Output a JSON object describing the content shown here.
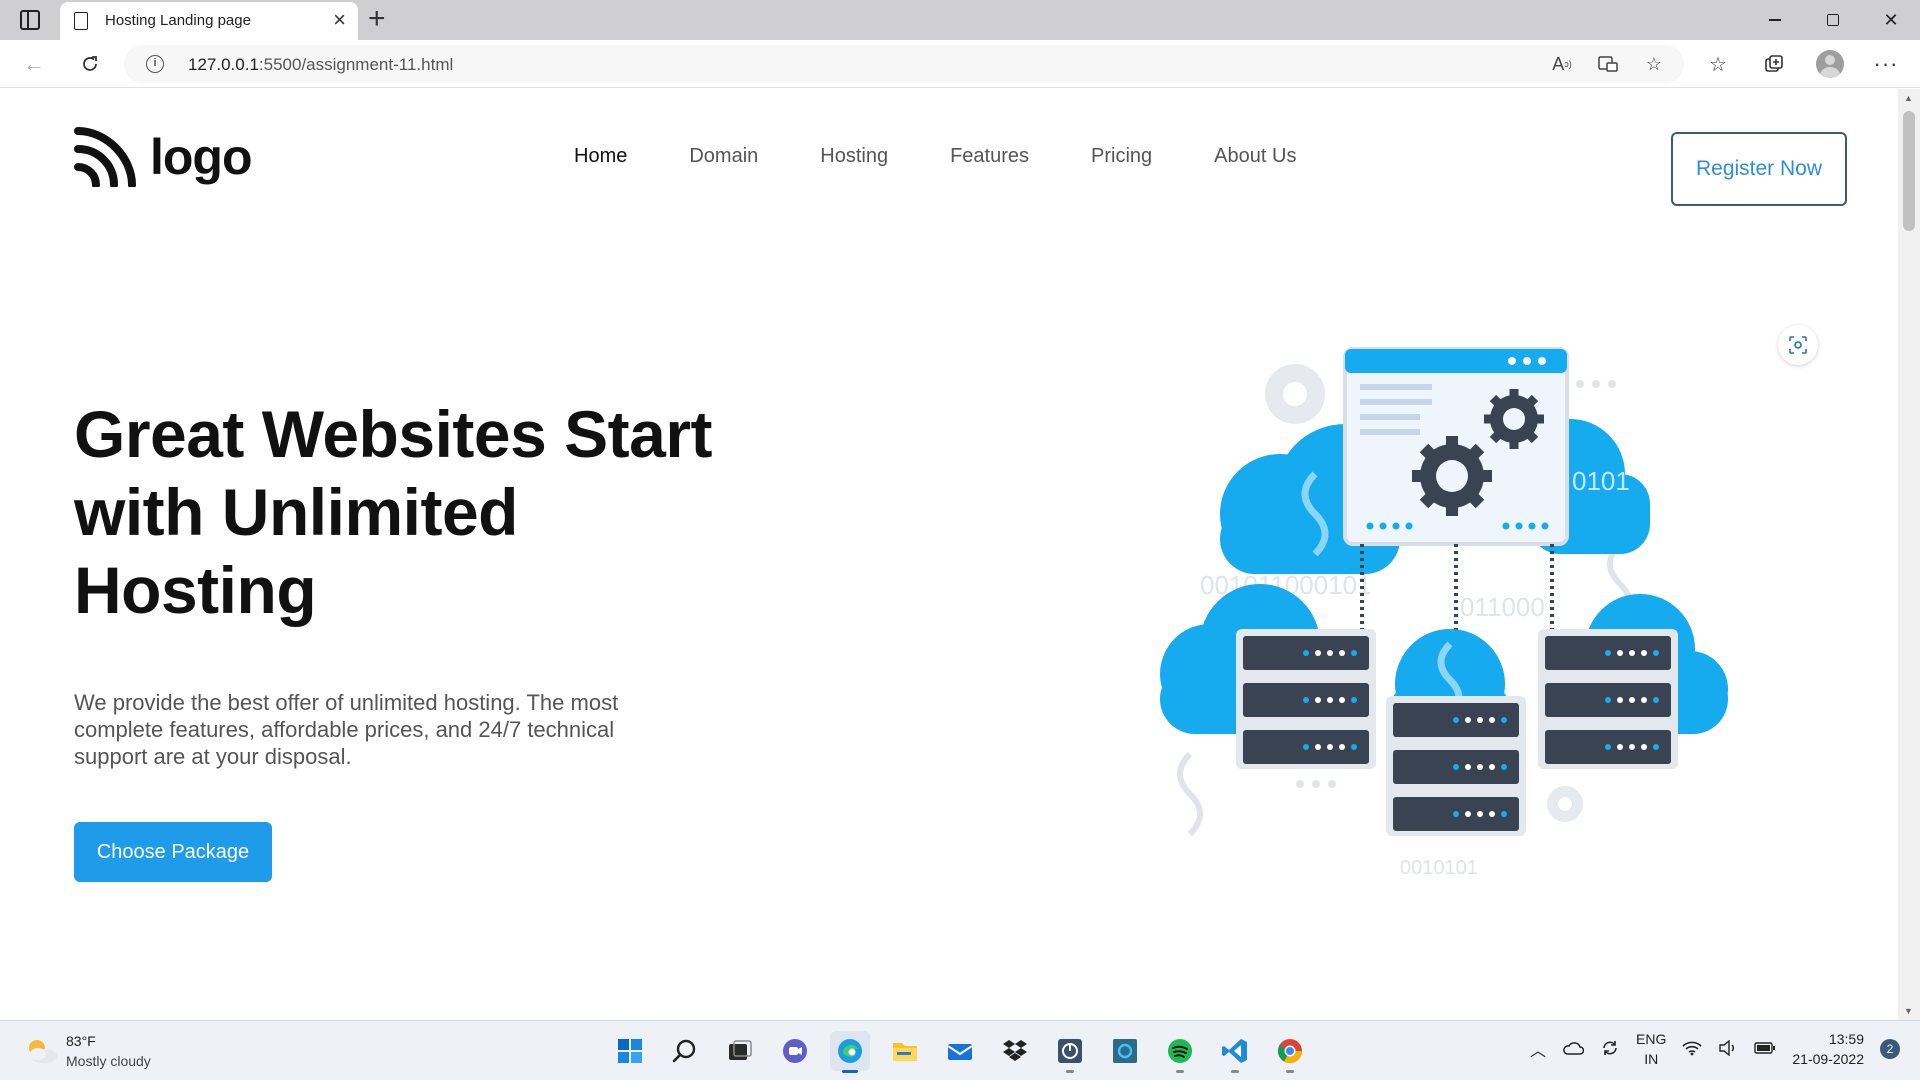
{
  "browser": {
    "tab_title": "Hosting Landing page",
    "url_host": "127.0.0.1",
    "url_rest": ":5500/assignment-11.html"
  },
  "page": {
    "logo_text": "logo",
    "nav": [
      {
        "label": "Home",
        "active": true
      },
      {
        "label": "Domain",
        "active": false
      },
      {
        "label": "Hosting",
        "active": false
      },
      {
        "label": "Features",
        "active": false
      },
      {
        "label": "Pricing",
        "active": false
      },
      {
        "label": "About Us",
        "active": false
      }
    ],
    "register_label": "Register Now",
    "hero": {
      "title": "Great Websites Start with Unlimited Hosting",
      "subtitle": "We provide the best offer of unlimited hosting. The most complete features, affordable prices, and 24/7 technical support are at your disposal.",
      "cta_label": "Choose Package",
      "art_labels": [
        "0101",
        "001011000101",
        "011000",
        "0010101"
      ]
    }
  },
  "colors": {
    "accent": "#1e9be9",
    "cloud": "#16aaee",
    "server": "#3a4352",
    "register_border": "#3c5a72",
    "register_text": "#2d8fd5"
  },
  "taskbar": {
    "weather_temp": "83°F",
    "weather_desc": "Mostly cloudy",
    "apps": [
      "start-icon",
      "search-icon",
      "task-view-icon",
      "chat-icon",
      "edge-icon",
      "file-explorer-icon",
      "mail-icon",
      "dropbox-icon",
      "app-icon",
      "cortana-icon",
      "spotify-icon",
      "vscode-icon",
      "chrome-icon"
    ],
    "lang_line1": "ENG",
    "lang_line2": "IN",
    "time": "13:59",
    "date": "21-09-2022",
    "notifications": "2"
  }
}
